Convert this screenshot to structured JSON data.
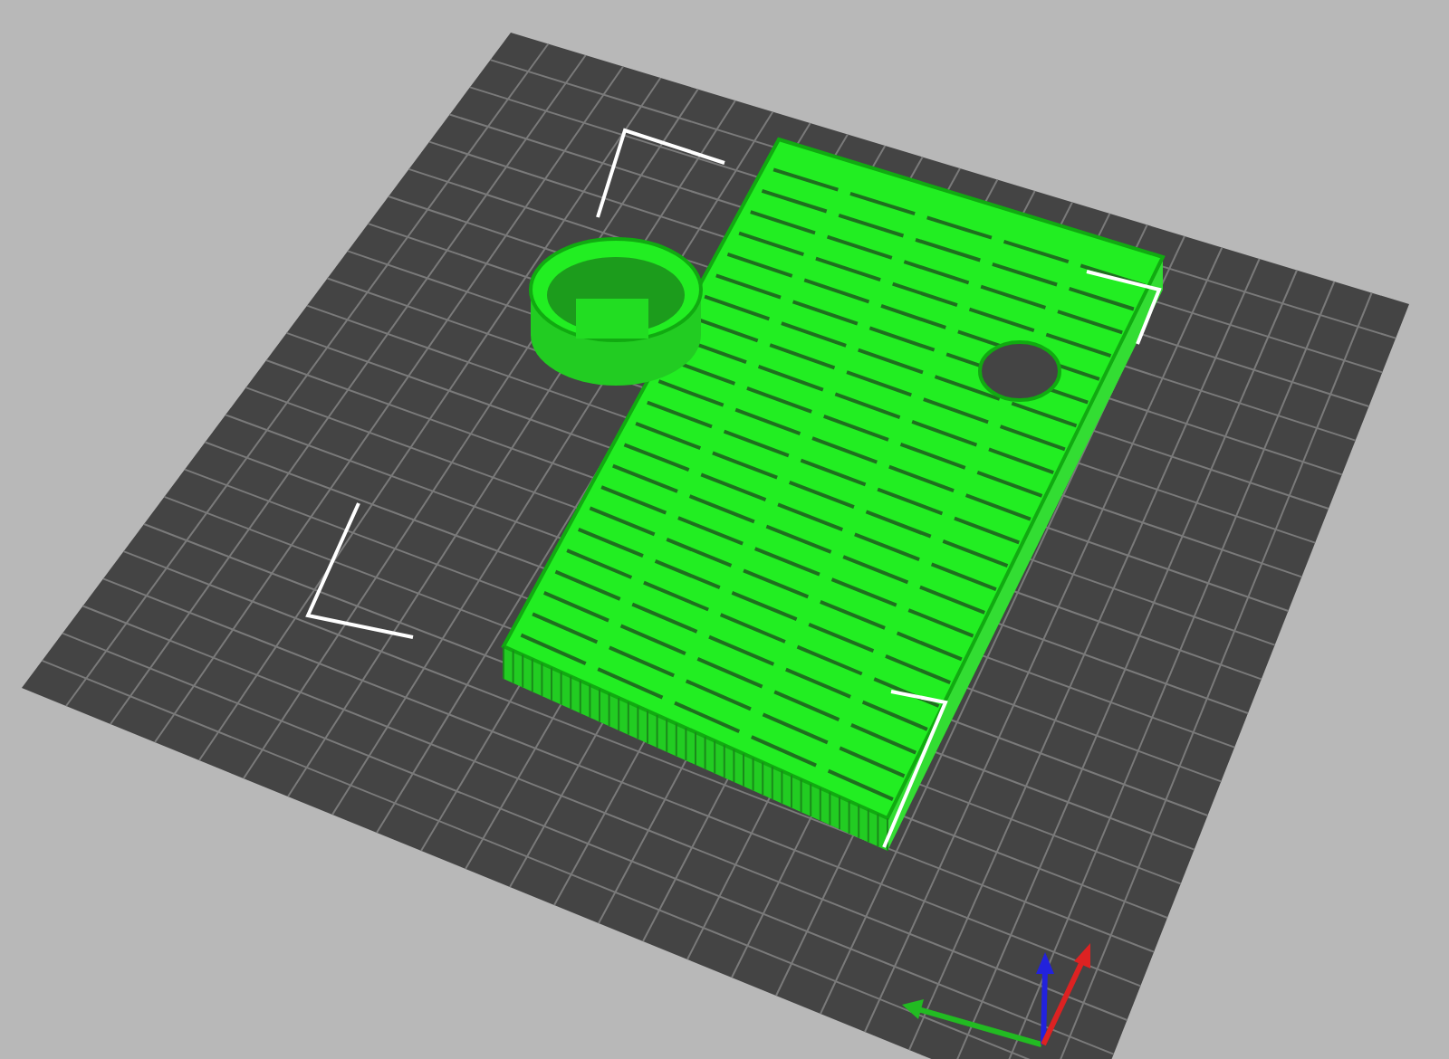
{
  "viewport": {
    "objects": [
      {
        "kind": "tray"
      },
      {
        "kind": "ring"
      }
    ],
    "axes": {
      "kind": "xyz"
    }
  }
}
